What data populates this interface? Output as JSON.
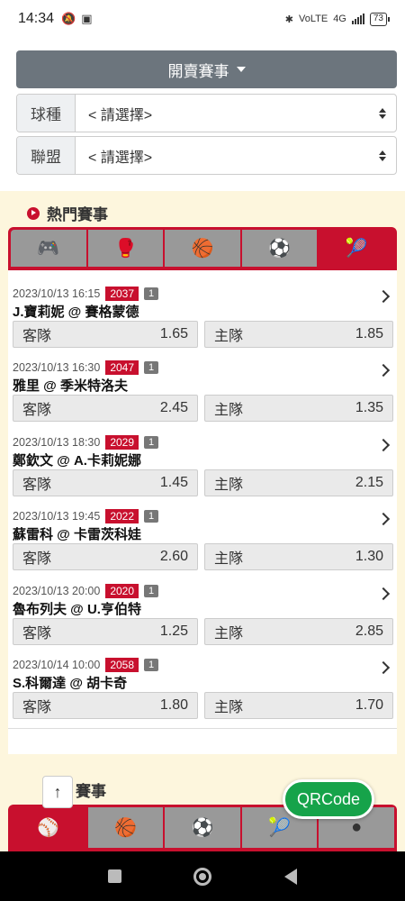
{
  "status_bar": {
    "time": "14:34",
    "battery": "73",
    "network": "4G"
  },
  "top": {
    "dropdown_label": "開賣賽事",
    "filters": [
      {
        "label": "球種",
        "value": "< 請選擇>"
      },
      {
        "label": "聯盟",
        "value": "< 請選擇>"
      }
    ]
  },
  "hot": {
    "title": "熱門賽事",
    "tabs": [
      {
        "icon": "gamepad-icon",
        "glyph": "🎮",
        "active": false
      },
      {
        "icon": "boxing-glove-icon",
        "glyph": "🥊",
        "active": false
      },
      {
        "icon": "basketball-icon",
        "glyph": "🏀",
        "active": false
      },
      {
        "icon": "soccer-ball-icon",
        "glyph": "⚽",
        "active": false
      },
      {
        "icon": "tennis-ball-icon",
        "glyph": "🎾",
        "active": true
      }
    ],
    "away_label": "客隊",
    "home_label": "主隊",
    "matches": [
      {
        "datetime": "2023/10/13 16:15",
        "code": "2037",
        "num": "1",
        "teams": "J.寶莉妮 @ 賽格蒙德",
        "away": "1.65",
        "home": "1.85"
      },
      {
        "datetime": "2023/10/13 16:30",
        "code": "2047",
        "num": "1",
        "teams": "雅里 @ 季米特洛夫",
        "away": "2.45",
        "home": "1.35"
      },
      {
        "datetime": "2023/10/13 18:30",
        "code": "2029",
        "num": "1",
        "teams": "鄭欽文 @ A.卡莉妮娜",
        "away": "1.45",
        "home": "2.15"
      },
      {
        "datetime": "2023/10/13 19:45",
        "code": "2022",
        "num": "1",
        "teams": "蘇雷科 @ 卡雷茨科娃",
        "away": "2.60",
        "home": "1.30"
      },
      {
        "datetime": "2023/10/13 20:00",
        "code": "2020",
        "num": "1",
        "teams": "魯布列夫 @ U.亨伯特",
        "away": "1.25",
        "home": "2.85"
      },
      {
        "datetime": "2023/10/14 10:00",
        "code": "2058",
        "num": "1",
        "teams": "S.科爾達 @ 胡卡奇",
        "away": "1.80",
        "home": "1.70"
      }
    ]
  },
  "second": {
    "title_visible": "賽事",
    "tabs": [
      {
        "icon": "baseball-icon",
        "glyph": "⚾",
        "active": true
      },
      {
        "icon": "basketball-icon",
        "glyph": "🏀",
        "active": false
      },
      {
        "icon": "soccer-ball-icon",
        "glyph": "⚽",
        "active": false
      },
      {
        "icon": "tennis-ball-icon",
        "glyph": "🎾",
        "active": false
      },
      {
        "icon": "hockey-puck-icon",
        "glyph": "●",
        "active": false
      }
    ]
  },
  "floating": {
    "scroll_top": "↑",
    "qr_label": "QRCode"
  },
  "colors": {
    "accent": "#c8102e",
    "cream": "#fdf6dd",
    "qr_green": "#16a34a",
    "header_button": "#6c757d"
  }
}
